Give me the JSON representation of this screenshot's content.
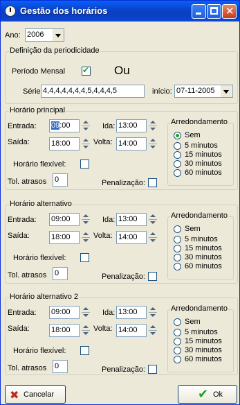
{
  "window": {
    "title": "Gestão dos horários"
  },
  "ano": {
    "label": "Ano:",
    "value": "2006"
  },
  "periodicidade": {
    "group_label": "Definição da periodicidade",
    "mensal_label": "Período Mensal",
    "mensal_checked": true,
    "ou_label": "Ou",
    "serie_label": "Série:",
    "serie_value": "4,4,4,4,4,4,4,5,4,4,4,5",
    "inicio_label": "início:",
    "inicio_value": "07-11-2005"
  },
  "labels": {
    "entrada": "Entrada:",
    "saida": "Saída:",
    "ida": "Ida:",
    "volta": "Volta:",
    "flexivel": "Horário flexível:",
    "tol": "Tol. atrasos",
    "penalizacao": "Penalização:",
    "arredondamento": "Arredondamento",
    "round_options": [
      "Sem",
      "5  minutos",
      "15 minutos",
      "30 minutos",
      "60 minutos"
    ]
  },
  "horarios": [
    {
      "group_label": "Horário principal",
      "entrada_h": "09",
      "entrada_m": ":00",
      "saida": "18:00",
      "ida": "13:00",
      "volta": "14:00",
      "tol": "0",
      "flexivel": false,
      "penalizacao": false,
      "round_selected": 0
    },
    {
      "group_label": "Horário alternativo",
      "entrada_h": "09",
      "entrada_m": ":00",
      "saida": "18:00",
      "ida": "13:00",
      "volta": "14:00",
      "tol": "0",
      "flexivel": false,
      "penalizacao": false,
      "round_selected": -1
    },
    {
      "group_label": "Horário alternativo 2",
      "entrada_h": "09",
      "entrada_m": ":00",
      "saida": "18:00",
      "ida": "13:00",
      "volta": "14:00",
      "tol": "0",
      "flexivel": false,
      "penalizacao": false,
      "round_selected": -1
    }
  ],
  "footer": {
    "cancel_label": "Cancelar",
    "ok_label": "Ok"
  },
  "colors": {
    "titlebar": "#0a5ff5",
    "face": "#ece9d8",
    "check": "#21a121"
  }
}
